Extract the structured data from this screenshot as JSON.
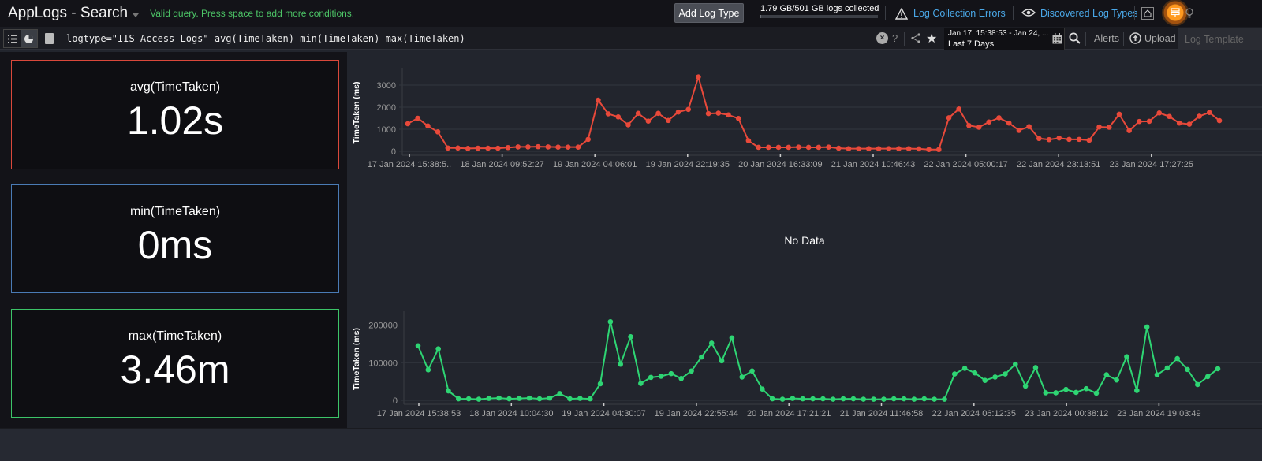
{
  "header": {
    "app_title": "AppLogs - Search",
    "status_message": "Valid query. Press space to add more conditions.",
    "add_log_type_label": "Add Log Type",
    "quota_text": "1.79 GB/501 GB logs collected",
    "quota_fraction": 0.0036,
    "log_collection_errors_label": "Log Collection Errors",
    "discovered_log_types_label": "Discovered Log Types",
    "icons": [
      "home-icon",
      "signpost-icon",
      "lightbulb-icon"
    ]
  },
  "toolbar": {
    "query": "logtype=\"IIS Access Logs\" avg(TimeTaken) min(TimeTaken) max(TimeTaken)",
    "date_range": "Jan 17, 15:38:53 - Jan 24, ...",
    "date_preset": "Last 7 Days",
    "help_label": "?",
    "alerts_label": "Alerts",
    "upload_label": "Upload",
    "log_template_label": "Log Template"
  },
  "stats": [
    {
      "label": "avg(TimeTaken)",
      "value": "1.02s",
      "color": "#d9483b"
    },
    {
      "label": "min(TimeTaken)",
      "value": "0ms",
      "color": "#4a7bb5"
    },
    {
      "label": "max(TimeTaken)",
      "value": "3.46m",
      "color": "#3cc468"
    }
  ],
  "no_data_label": "No Data",
  "chart_data": [
    {
      "type": "line",
      "title": "avg(TimeTaken)",
      "xlabel": "",
      "ylabel": "TimeTaken (ms)",
      "ylim": [
        0,
        3500
      ],
      "yticks": [
        0,
        1000,
        2000,
        3000
      ],
      "grid": true,
      "color": "#e8493a",
      "x_tick_labels": [
        "17 Jan 2024 15:38:5..",
        "18 Jan 2024 09:52:27",
        "19 Jan 2024 04:06:01",
        "19 Jan 2024 22:19:35",
        "20 Jan 2024 16:33:09",
        "21 Jan 2024 10:46:43",
        "22 Jan 2024 05:00:17",
        "22 Jan 2024 23:13:51",
        "23 Jan 2024 17:27:25"
      ],
      "values": [
        1250,
        1500,
        1150,
        880,
        150,
        150,
        130,
        140,
        140,
        140,
        170,
        200,
        200,
        210,
        200,
        190,
        190,
        190,
        540,
        2320,
        1700,
        1560,
        1200,
        1720,
        1370,
        1720,
        1400,
        1780,
        1900,
        3370,
        1710,
        1730,
        1650,
        1490,
        480,
        180,
        180,
        180,
        180,
        190,
        180,
        180,
        190,
        140,
        120,
        120,
        120,
        120,
        120,
        120,
        120,
        110,
        80,
        80,
        1520,
        1920,
        1170,
        1090,
        1330,
        1520,
        1280,
        950,
        1120,
        580,
        530,
        600,
        540,
        540,
        500,
        1100,
        1090,
        1680,
        940,
        1350,
        1360,
        1740,
        1580,
        1280,
        1230,
        1590,
        1760,
        1390
      ]
    },
    {
      "type": "line",
      "title": "min(TimeTaken)",
      "no_data": true
    },
    {
      "type": "line",
      "title": "max(TimeTaken)",
      "xlabel": "",
      "ylabel": "TimeTaken (ms)",
      "ylim": [
        0,
        220000
      ],
      "yticks": [
        0,
        100000,
        200000
      ],
      "grid": true,
      "color": "#2ed573",
      "x_tick_labels": [
        "17 Jan 2024 15:38:53",
        "18 Jan 2024 10:04:30",
        "19 Jan 2024 04:30:07",
        "19 Jan 2024 22:55:44",
        "20 Jan 2024 17:21:21",
        "21 Jan 2024 11:46:58",
        "22 Jan 2024 06:12:35",
        "23 Jan 2024 00:38:12",
        "23 Jan 2024 19:03:49"
      ],
      "values": [
        145000,
        81000,
        137000,
        25000,
        4000,
        4000,
        3000,
        5000,
        6000,
        4000,
        5000,
        6000,
        4000,
        6000,
        18000,
        4000,
        5000,
        4000,
        44000,
        209000,
        96000,
        169000,
        45000,
        61000,
        64000,
        71000,
        58000,
        78000,
        115000,
        152000,
        105000,
        166000,
        62000,
        78000,
        30000,
        4000,
        3000,
        5000,
        4000,
        4000,
        4000,
        3000,
        4000,
        4000,
        3000,
        3000,
        3000,
        4000,
        4000,
        3000,
        4000,
        3000,
        3000,
        70000,
        85000,
        73000,
        53000,
        62000,
        70000,
        96000,
        38000,
        87000,
        20000,
        20000,
        29000,
        21000,
        31000,
        19000,
        68000,
        54000,
        116000,
        26000,
        195000,
        68000,
        86000,
        111000,
        82000,
        42000,
        63000,
        84000
      ]
    }
  ]
}
